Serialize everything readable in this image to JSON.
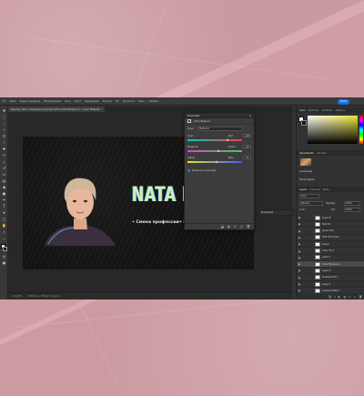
{
  "app": {
    "menu": [
      "Файл",
      "Редактирование",
      "Изображение",
      "Слои",
      "Текст",
      "Выделение",
      "Фильтр",
      "3D",
      "Просмотр",
      "Окно",
      "Справка"
    ],
    "share_label": "Share"
  },
  "document": {
    "tab_title": "Баннер 2021 (сохранено).psd @ 113% (Color Balance 1, Layer Mask/8) *",
    "headline": "NATA D",
    "subtitle": "• Смена профессии• Конт"
  },
  "status": {
    "zoom": "113.26%",
    "info": "2000 px x 700 px (72 ppi)"
  },
  "properties": {
    "title": "Properties",
    "subtitle": "Color Balance",
    "tone_label": "Tone:",
    "tone_value": "Midtones",
    "sliders": [
      {
        "left": "Cyan",
        "right": "Red",
        "value": "+18",
        "position": 0.74
      },
      {
        "left": "Magenta",
        "right": "Green",
        "value": "+8",
        "position": 0.58
      },
      {
        "left": "Yellow",
        "right": "Blue",
        "value": "+4",
        "position": 0.54
      }
    ],
    "preserve_label": "Preserve Luminosity"
  },
  "midpanel": {
    "title": "Properties"
  },
  "color_panel": {
    "tabs": [
      "Color",
      "Swatches",
      "Gradients",
      "Patterns"
    ],
    "adjustments_tabs": [
      "Adjustments",
      "Libraries"
    ],
    "sections": [
      "Landscape",
      "Photo Repair"
    ],
    "picker_color": "#ece53a"
  },
  "layers_panel": {
    "tabs": [
      "Layers",
      "Channels",
      "Paths"
    ],
    "kind": "Kind",
    "blend": "Normal",
    "opacity_label": "Opacity:",
    "opacity": "100%",
    "lock_label": "Lock:",
    "fill_label": "Fill:",
    "fill": "100%",
    "layers": [
      {
        "name": "Layer 8",
        "selected": false
      },
      {
        "name": "Text 10",
        "selected": false
      },
      {
        "name": "guard star",
        "selected": false
      },
      {
        "name": "Text Font Color",
        "selected": false
      },
      {
        "name": "Group",
        "selected": false
      },
      {
        "name": "Color Fill 2",
        "selected": false
      },
      {
        "name": "Level 1",
        "selected": false
      },
      {
        "name": "Color Balance 1",
        "selected": true
      },
      {
        "name": "Layer 4",
        "selected": false
      },
      {
        "name": "Gradient Fill 1",
        "selected": false
      },
      {
        "name": "Layer 3",
        "selected": false
      },
      {
        "name": "Gradient Map 1",
        "selected": false
      }
    ]
  }
}
